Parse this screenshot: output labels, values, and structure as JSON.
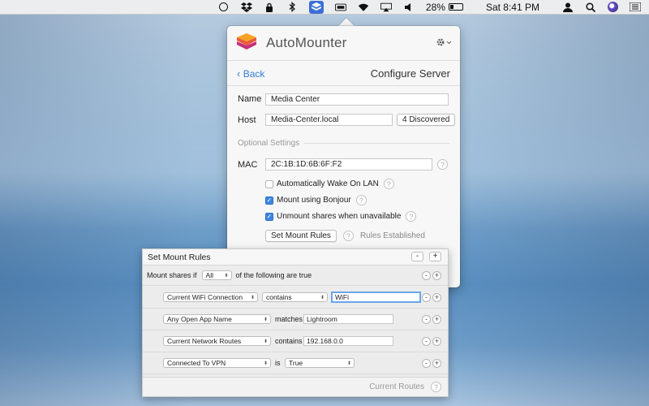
{
  "menubar": {
    "battery": "28%",
    "clock": "Sat 8:41 PM",
    "icons": [
      "record-icon",
      "dropbox-icon",
      "lock-icon",
      "bluetooth-icon",
      "automounter-icon",
      "keyboard-icon",
      "wifi-icon",
      "airplay-icon",
      "volume-icon",
      "battery-icon",
      "user-icon",
      "search-icon",
      "siri-icon",
      "list-icon"
    ]
  },
  "app": {
    "title": "AutoMounter",
    "nav_back": "Back",
    "nav_title": "Configure Server"
  },
  "form": {
    "name_label": "Name",
    "name_value": "Media Center",
    "host_label": "Host",
    "host_value": "Media-Center.local",
    "discovered_button": "4 Discovered",
    "optional_label": "Optional Settings",
    "mac_label": "MAC",
    "mac_value": "2C:1B:1D:6B:6F:F2",
    "wake_label": "Automatically Wake On LAN",
    "wake_checked": false,
    "bonjour_label": "Mount using Bonjour",
    "bonjour_checked": true,
    "unmount_label": "Unmount shares when unavailable",
    "unmount_checked": true,
    "mount_rules_button": "Set Mount Rules",
    "rules_status": "Rules Established",
    "help": "?"
  },
  "rules": {
    "title": "Set Mount Rules",
    "prefix": "Mount shares if",
    "match_mode": "All",
    "suffix": "of the following are true",
    "items": [
      {
        "field": "Current WiFi Connection",
        "operator": "contains",
        "operator_is_popup": true,
        "value": "WiFi",
        "value_is_popup": false
      },
      {
        "field": "Any Open App Name",
        "operator": "matches",
        "operator_is_popup": false,
        "value": "Lightroom",
        "value_is_popup": false
      },
      {
        "field": "Current Network Routes",
        "operator": "contains",
        "operator_is_popup": false,
        "value": "192.168.0.0",
        "value_is_popup": false
      },
      {
        "field": "Connected To VPN",
        "operator": "is",
        "operator_is_popup": false,
        "value": "True",
        "value_is_popup": true
      }
    ],
    "footer_link": "Current Routes",
    "minus": "-",
    "plus": "+"
  }
}
